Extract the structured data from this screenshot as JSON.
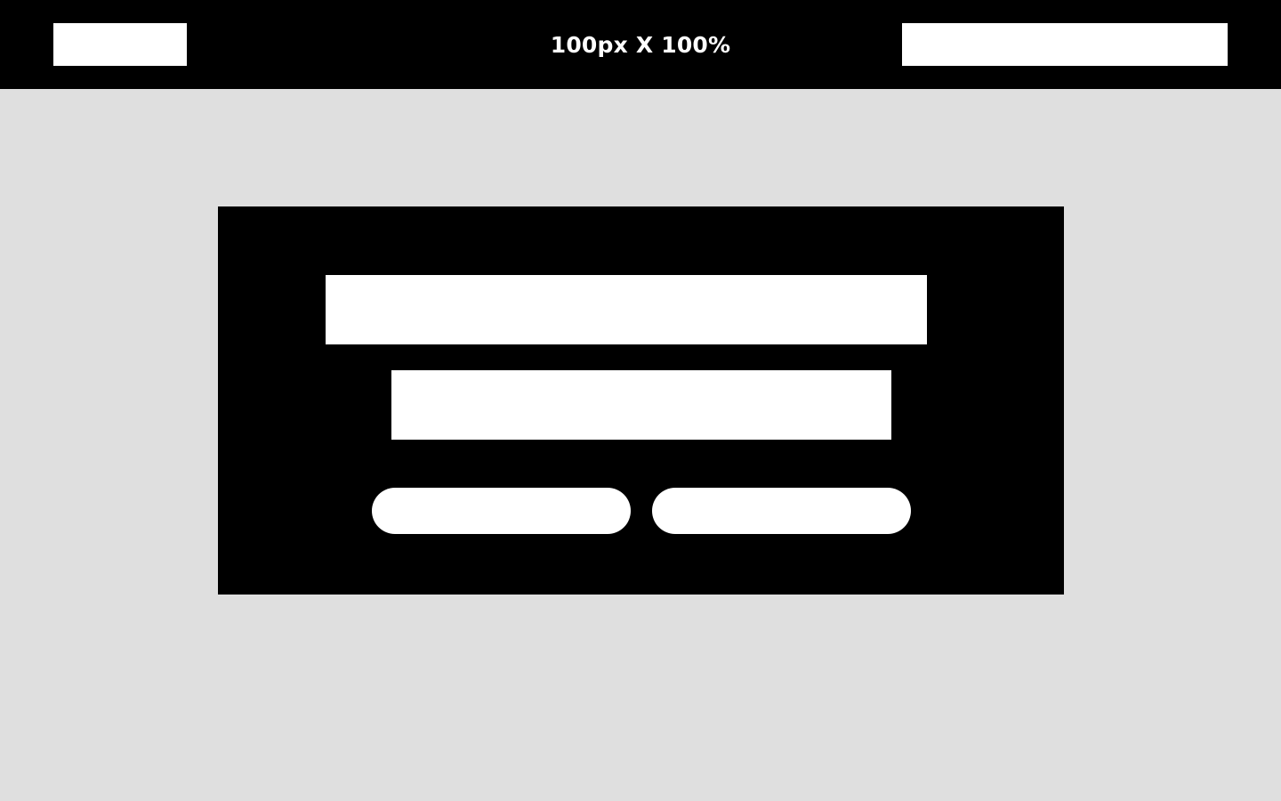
{
  "header": {
    "title": "100px X 100%",
    "logo_label": "",
    "nav_label": ""
  },
  "hero": {
    "headline": "",
    "subheadline": "",
    "primary_button_label": "",
    "secondary_button_label": ""
  },
  "colors": {
    "header_background": "#000000",
    "page_background": "#dfdfdf",
    "hero_background": "#000000",
    "placeholder_fill": "#ffffff",
    "header_text": "#ffffff"
  }
}
